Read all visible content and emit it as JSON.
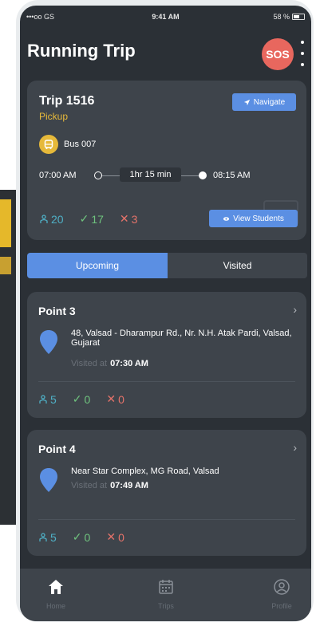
{
  "status_bar": {
    "carrier": "•••oo GS",
    "time": "9:41 AM",
    "battery": "58 %"
  },
  "header": {
    "title": "Running Trip",
    "sos_label": "SOS"
  },
  "trip": {
    "title": "Trip 1516",
    "type": "Pickup",
    "navigate_label": "Navigate",
    "bus": "Bus 007",
    "departure": "07:00 AM",
    "duration": "1hr 15 min",
    "arrival": "08:15 AM",
    "students_total": "20",
    "students_present": "17",
    "students_absent": "3",
    "view_students_label": "View Students"
  },
  "tabs": [
    {
      "label": "Upcoming",
      "active": true
    },
    {
      "label": "Visited",
      "active": false
    }
  ],
  "points": [
    {
      "title": "Point 3",
      "address": "48, Valsad - Dharampur Rd., Nr. N.H. Atak Pardi, Valsad, Gujarat",
      "visited_label": "Visited at",
      "visited_time": "07:30 AM",
      "total": "5",
      "present": "0",
      "absent": "0"
    },
    {
      "title": "Point 4",
      "address": "Near Star Complex, MG Road, Valsad",
      "visited_label": "Visited at",
      "visited_time": "07:49 AM",
      "total": "5",
      "present": "0",
      "absent": "0"
    }
  ],
  "bottom_nav": [
    {
      "label": "Home",
      "icon": "home-icon"
    },
    {
      "label": "Trips",
      "icon": "calendar-icon"
    },
    {
      "label": "Profile",
      "icon": "profile-icon"
    }
  ],
  "colors": {
    "accent": "#5b8fe3",
    "sos": "#e8675e",
    "pickup": "#e6b93a",
    "card": "#3e444b",
    "background": "#2b3036"
  },
  "icons": {
    "students": "students-icon",
    "present": "check-icon",
    "absent": "cross-icon",
    "pin": "location-pin-icon",
    "bus": "bus-icon"
  }
}
